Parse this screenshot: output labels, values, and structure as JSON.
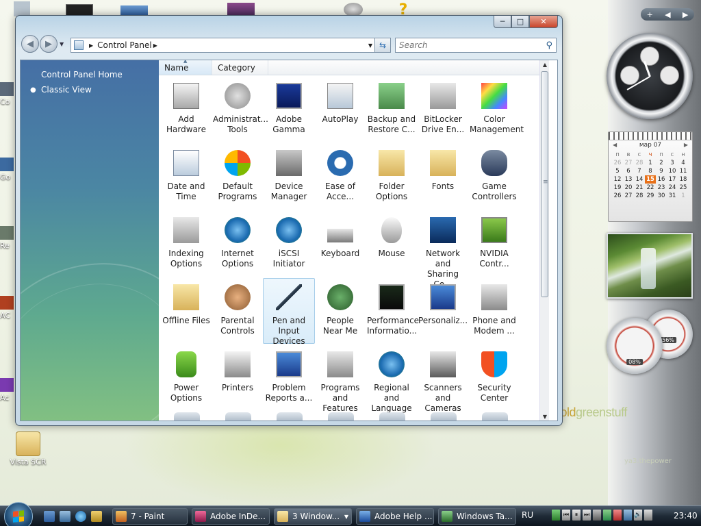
{
  "window": {
    "address": "Control Panel",
    "search_placeholder": "Search"
  },
  "tasks": {
    "home": "Control Panel Home",
    "classic": "Classic View"
  },
  "columns": {
    "name": "Name",
    "category": "Category"
  },
  "items": [
    {
      "label": "Add Hardware",
      "icon": "add-hardware-icon"
    },
    {
      "label": "Administrat... Tools",
      "icon": "administrative-tools-icon"
    },
    {
      "label": "Adobe Gamma",
      "icon": "adobe-gamma-icon"
    },
    {
      "label": "AutoPlay",
      "icon": "autoplay-icon"
    },
    {
      "label": "Backup and Restore C...",
      "icon": "backup-restore-icon"
    },
    {
      "label": "BitLocker Drive En...",
      "icon": "bitlocker-icon"
    },
    {
      "label": "Color Management",
      "icon": "color-management-icon"
    },
    {
      "label": "Date and Time",
      "icon": "date-time-icon"
    },
    {
      "label": "Default Programs",
      "icon": "default-programs-icon"
    },
    {
      "label": "Device Manager",
      "icon": "device-manager-icon"
    },
    {
      "label": "Ease of Acce...",
      "icon": "ease-of-access-icon"
    },
    {
      "label": "Folder Options",
      "icon": "folder-options-icon"
    },
    {
      "label": "Fonts",
      "icon": "fonts-icon"
    },
    {
      "label": "Game Controllers",
      "icon": "game-controllers-icon"
    },
    {
      "label": "Indexing Options",
      "icon": "indexing-options-icon"
    },
    {
      "label": "Internet Options",
      "icon": "internet-options-icon"
    },
    {
      "label": "iSCSI Initiator",
      "icon": "iscsi-initiator-icon"
    },
    {
      "label": "Keyboard",
      "icon": "keyboard-icon"
    },
    {
      "label": "Mouse",
      "icon": "mouse-icon"
    },
    {
      "label": "Network and Sharing Ce...",
      "icon": "network-sharing-icon"
    },
    {
      "label": "NVIDIA Contr...",
      "icon": "nvidia-control-icon"
    },
    {
      "label": "Offline Files",
      "icon": "offline-files-icon"
    },
    {
      "label": "Parental Controls",
      "icon": "parental-controls-icon"
    },
    {
      "label": "Pen and Input Devices",
      "icon": "pen-input-icon"
    },
    {
      "label": "People Near Me",
      "icon": "people-near-me-icon"
    },
    {
      "label": "Performance Informatio...",
      "icon": "performance-icon"
    },
    {
      "label": "Personaliz...",
      "icon": "personalization-icon"
    },
    {
      "label": "Phone and Modem ...",
      "icon": "phone-modem-icon"
    },
    {
      "label": "Power Options",
      "icon": "power-options-icon"
    },
    {
      "label": "Printers",
      "icon": "printers-icon"
    },
    {
      "label": "Problem Reports a...",
      "icon": "problem-reports-icon"
    },
    {
      "label": "Programs and Features",
      "icon": "programs-features-icon"
    },
    {
      "label": "Regional and Language ...",
      "icon": "regional-language-icon"
    },
    {
      "label": "Scanners and Cameras",
      "icon": "scanners-cameras-icon"
    },
    {
      "label": "Security Center",
      "icon": "security-center-icon"
    }
  ],
  "desktop": {
    "vista_scr": "Vista SCR",
    "strip_labels": [
      "Co",
      "Go",
      "Re",
      "AC",
      "Ac"
    ],
    "brand_a": "cold",
    "brand_b": "greenstuff",
    "brand_c": "ya3.thepower"
  },
  "gadgets": {
    "calendar_month": "мар 07",
    "weekdays": [
      "п",
      "в",
      "с",
      "ч",
      "п",
      "с",
      "н"
    ],
    "weeks": [
      [
        "26",
        "27",
        "28",
        "1",
        "2",
        "3",
        "4"
      ],
      [
        "5",
        "6",
        "7",
        "8",
        "9",
        "10",
        "11"
      ],
      [
        "12",
        "13",
        "14",
        "15",
        "16",
        "17",
        "18"
      ],
      [
        "19",
        "20",
        "21",
        "22",
        "23",
        "24",
        "25"
      ],
      [
        "26",
        "27",
        "28",
        "29",
        "30",
        "31",
        "1"
      ]
    ],
    "today": "15",
    "cpu": "08%",
    "mem": "56%"
  },
  "taskbar": {
    "buttons": [
      {
        "label": "7 - Paint"
      },
      {
        "label": "Adobe InDe..."
      },
      {
        "label": "3 Window..."
      },
      {
        "label": "Adobe Help ..."
      },
      {
        "label": "Windows Ta..."
      }
    ],
    "lang": "RU",
    "time": "23:40"
  },
  "colors": {
    "accent": "#2a6bb0",
    "selected": "#d9ecf9",
    "task_pane_top": "#456fa5",
    "task_pane_bottom": "#82c082",
    "today": "#e8711a"
  }
}
